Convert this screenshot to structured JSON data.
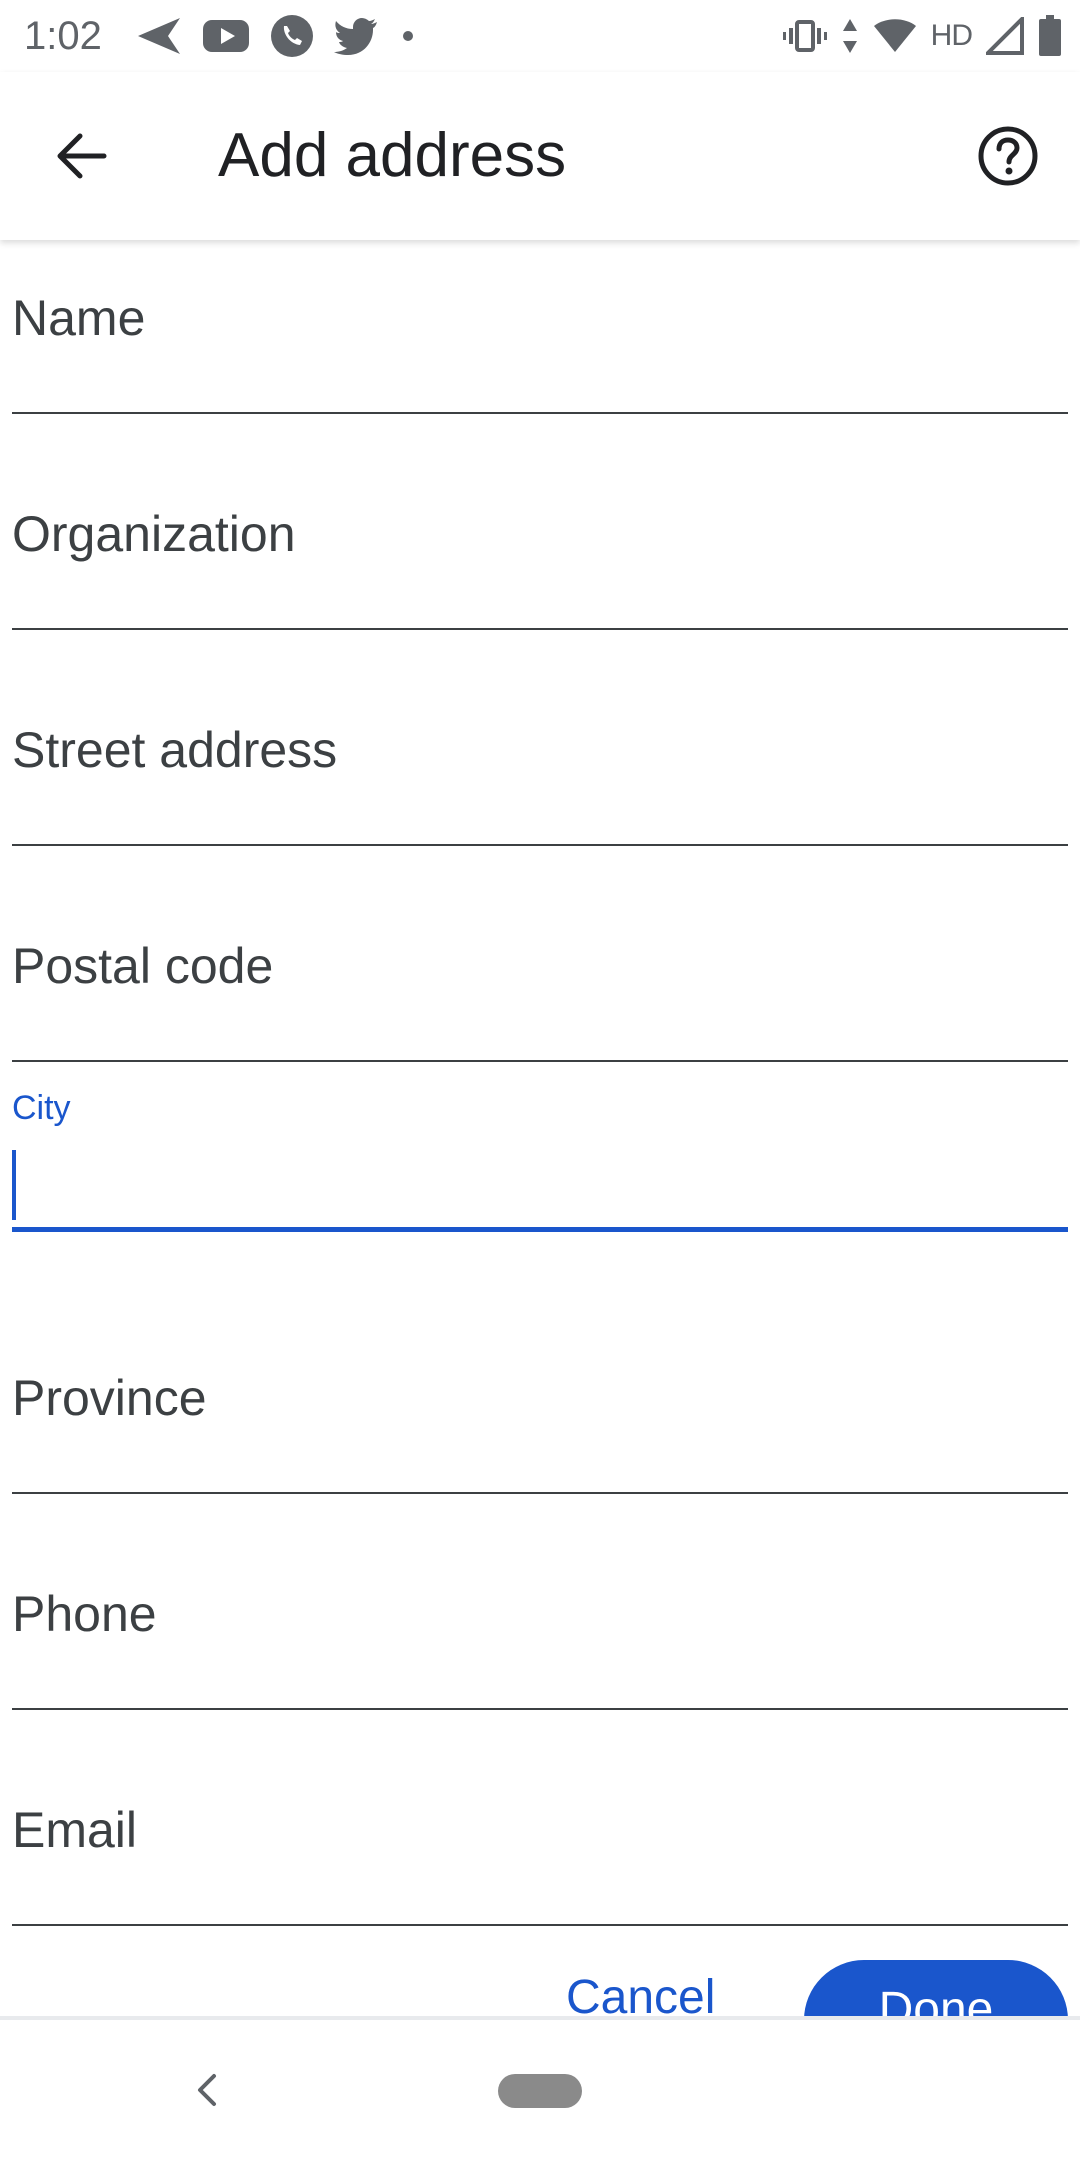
{
  "status_bar": {
    "time": "1:02",
    "left_icons": [
      "send-icon",
      "youtube-icon",
      "phone-icon",
      "twitter-icon",
      "dot-icon"
    ],
    "right_icons": [
      "vibrate-icon",
      "data-arrows-icon",
      "wifi-icon",
      "signal-icon",
      "battery-icon"
    ],
    "network_label": "HD"
  },
  "app_bar": {
    "title": "Add address",
    "back_icon": "arrow-back-icon",
    "help_icon": "help-circle-icon"
  },
  "form": {
    "fields": [
      {
        "label": "Name",
        "value": "",
        "focused": false
      },
      {
        "label": "Organization",
        "value": "",
        "focused": false
      },
      {
        "label": "Street address",
        "value": "",
        "focused": false
      },
      {
        "label": "Postal code",
        "value": "",
        "focused": false
      },
      {
        "label": "City",
        "value": "",
        "focused": true
      },
      {
        "label": "Province",
        "value": "",
        "focused": false
      },
      {
        "label": "Phone",
        "value": "",
        "focused": false
      },
      {
        "label": "Email",
        "value": "",
        "focused": false
      }
    ]
  },
  "actions": {
    "cancel_label": "Cancel",
    "done_label": "Done"
  },
  "colors": {
    "accent": "#1a56cc",
    "text_primary": "#202124",
    "text_secondary": "#3c4043",
    "status_icons": "#5f6368",
    "nav_pill": "#8a8a8a"
  },
  "nav_bar": {
    "back_icon": "nav-back-icon",
    "home_icon": "home-pill-icon"
  }
}
